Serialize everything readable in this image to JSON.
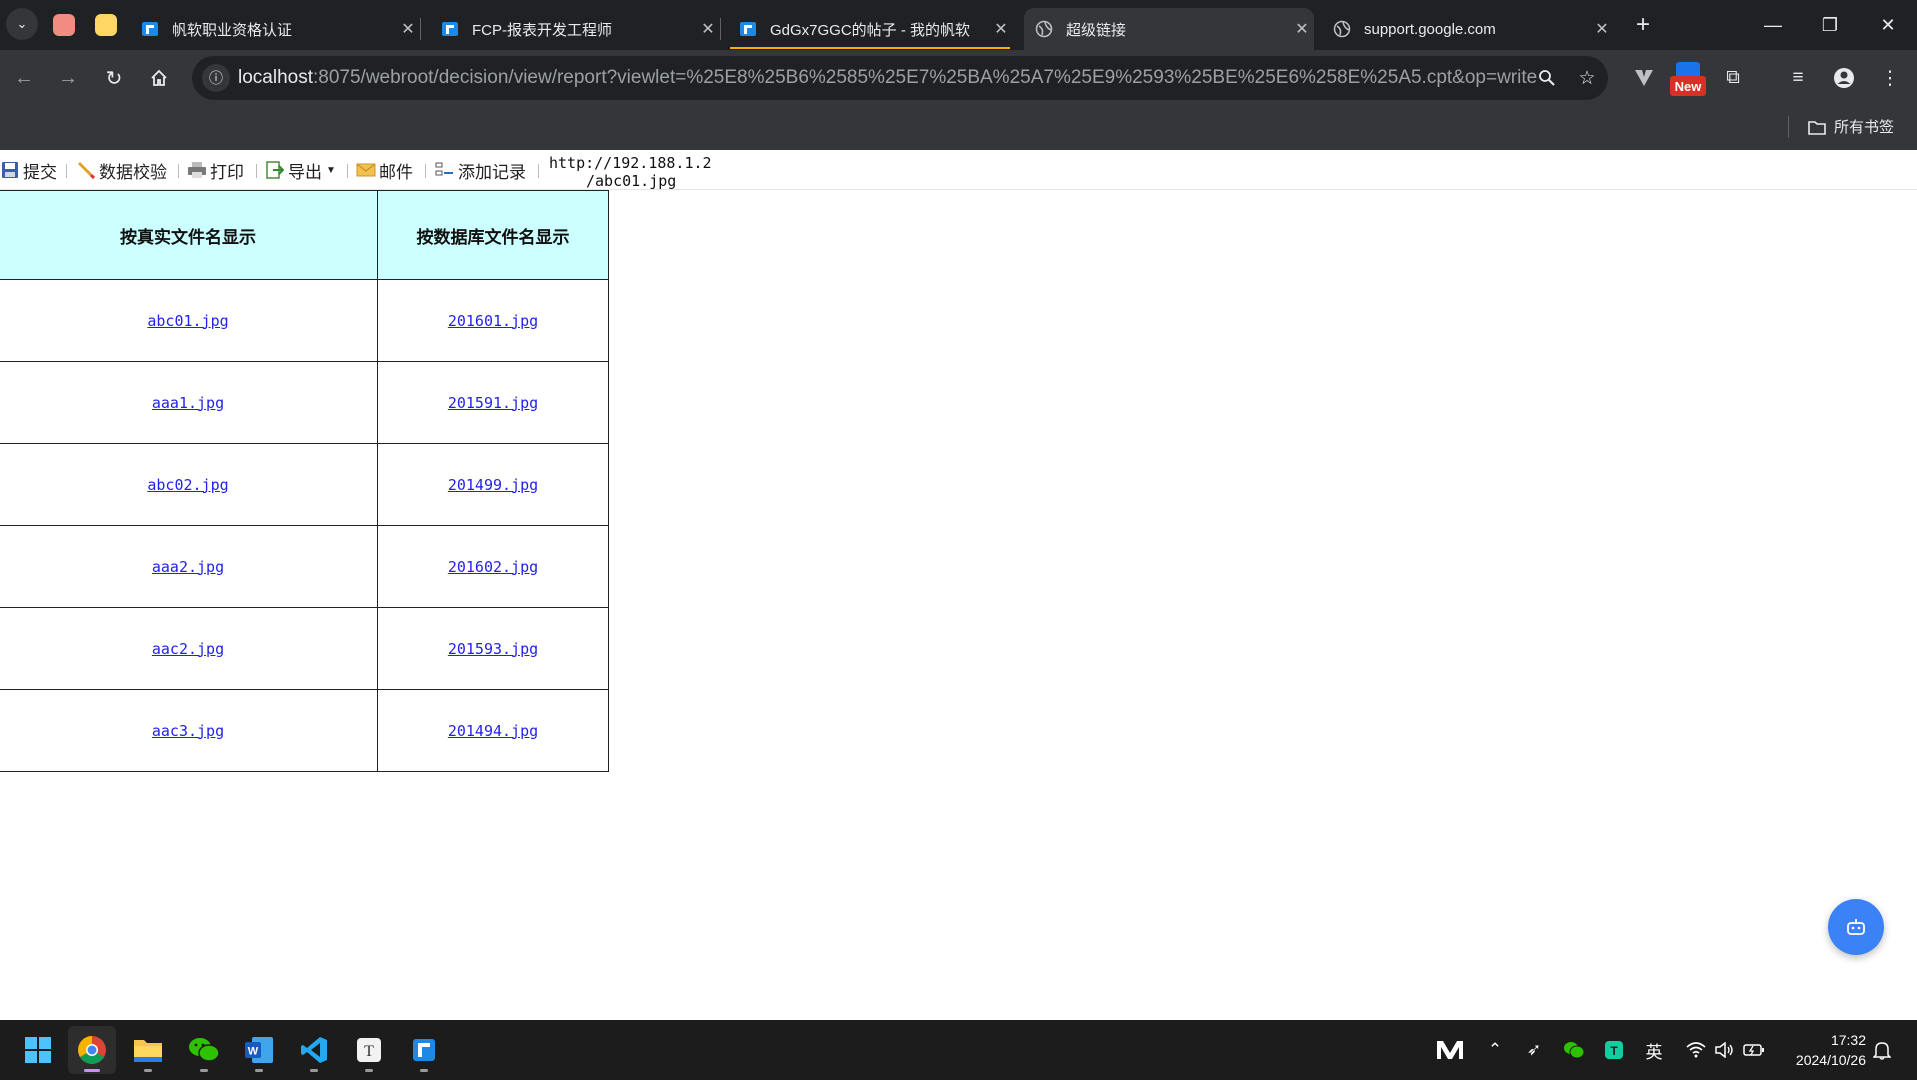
{
  "browser": {
    "tabs": [
      {
        "title": "帆软职业资格认证",
        "icon": "finereport-icon"
      },
      {
        "title": "FCP-报表开发工程师",
        "icon": "finereport-icon"
      },
      {
        "title": "GdGx7GGC的帖子 - 我的帆软",
        "icon": "finereport-icon"
      },
      {
        "title": "超级链接",
        "icon": "globe-icon",
        "active": true
      },
      {
        "title": "support.google.com",
        "icon": "globe-icon"
      }
    ],
    "url_host": "localhost",
    "url_rest": ":8075/webroot/decision/view/report?viewlet=%25E8%25B6%2585%25E7%25BA%25A7%25E9%2593%25BE%25E6%258E%25A5.cpt&op=write",
    "extension_badge": "New",
    "bookmarks_all": "所有书签"
  },
  "report_toolbar": {
    "submit": "提交",
    "validate": "数据校验",
    "print": "打印",
    "export": "导出",
    "mail": "邮件",
    "add_record": "添加记录",
    "tooltip_line1": "http://192.188.1.2",
    "tooltip_line2": "/abc01.jpg"
  },
  "table": {
    "headers": [
      "按真实文件名显示",
      "按数据库文件名显示"
    ],
    "rows": [
      [
        "abc01.jpg",
        "201601.jpg"
      ],
      [
        "aaa1.jpg",
        "201591.jpg"
      ],
      [
        "abc02.jpg",
        "201499.jpg"
      ],
      [
        "aaa2.jpg",
        "201602.jpg"
      ],
      [
        "aac2.jpg",
        "201593.jpg"
      ],
      [
        "aac3.jpg",
        "201494.jpg"
      ]
    ]
  },
  "taskbar": {
    "apps": [
      "windows-start-icon",
      "chrome-icon",
      "file-explorer-icon",
      "wechat-icon",
      "word-icon",
      "vscode-icon",
      "typora-icon",
      "finereport-icon"
    ],
    "ime": "英",
    "time": "17:32",
    "date": "2024/10/26"
  },
  "colors": {
    "header_bg": "#ccffff",
    "link": "#2222ee",
    "chrome_dark": "#202124",
    "fab": "#3b82f6"
  }
}
